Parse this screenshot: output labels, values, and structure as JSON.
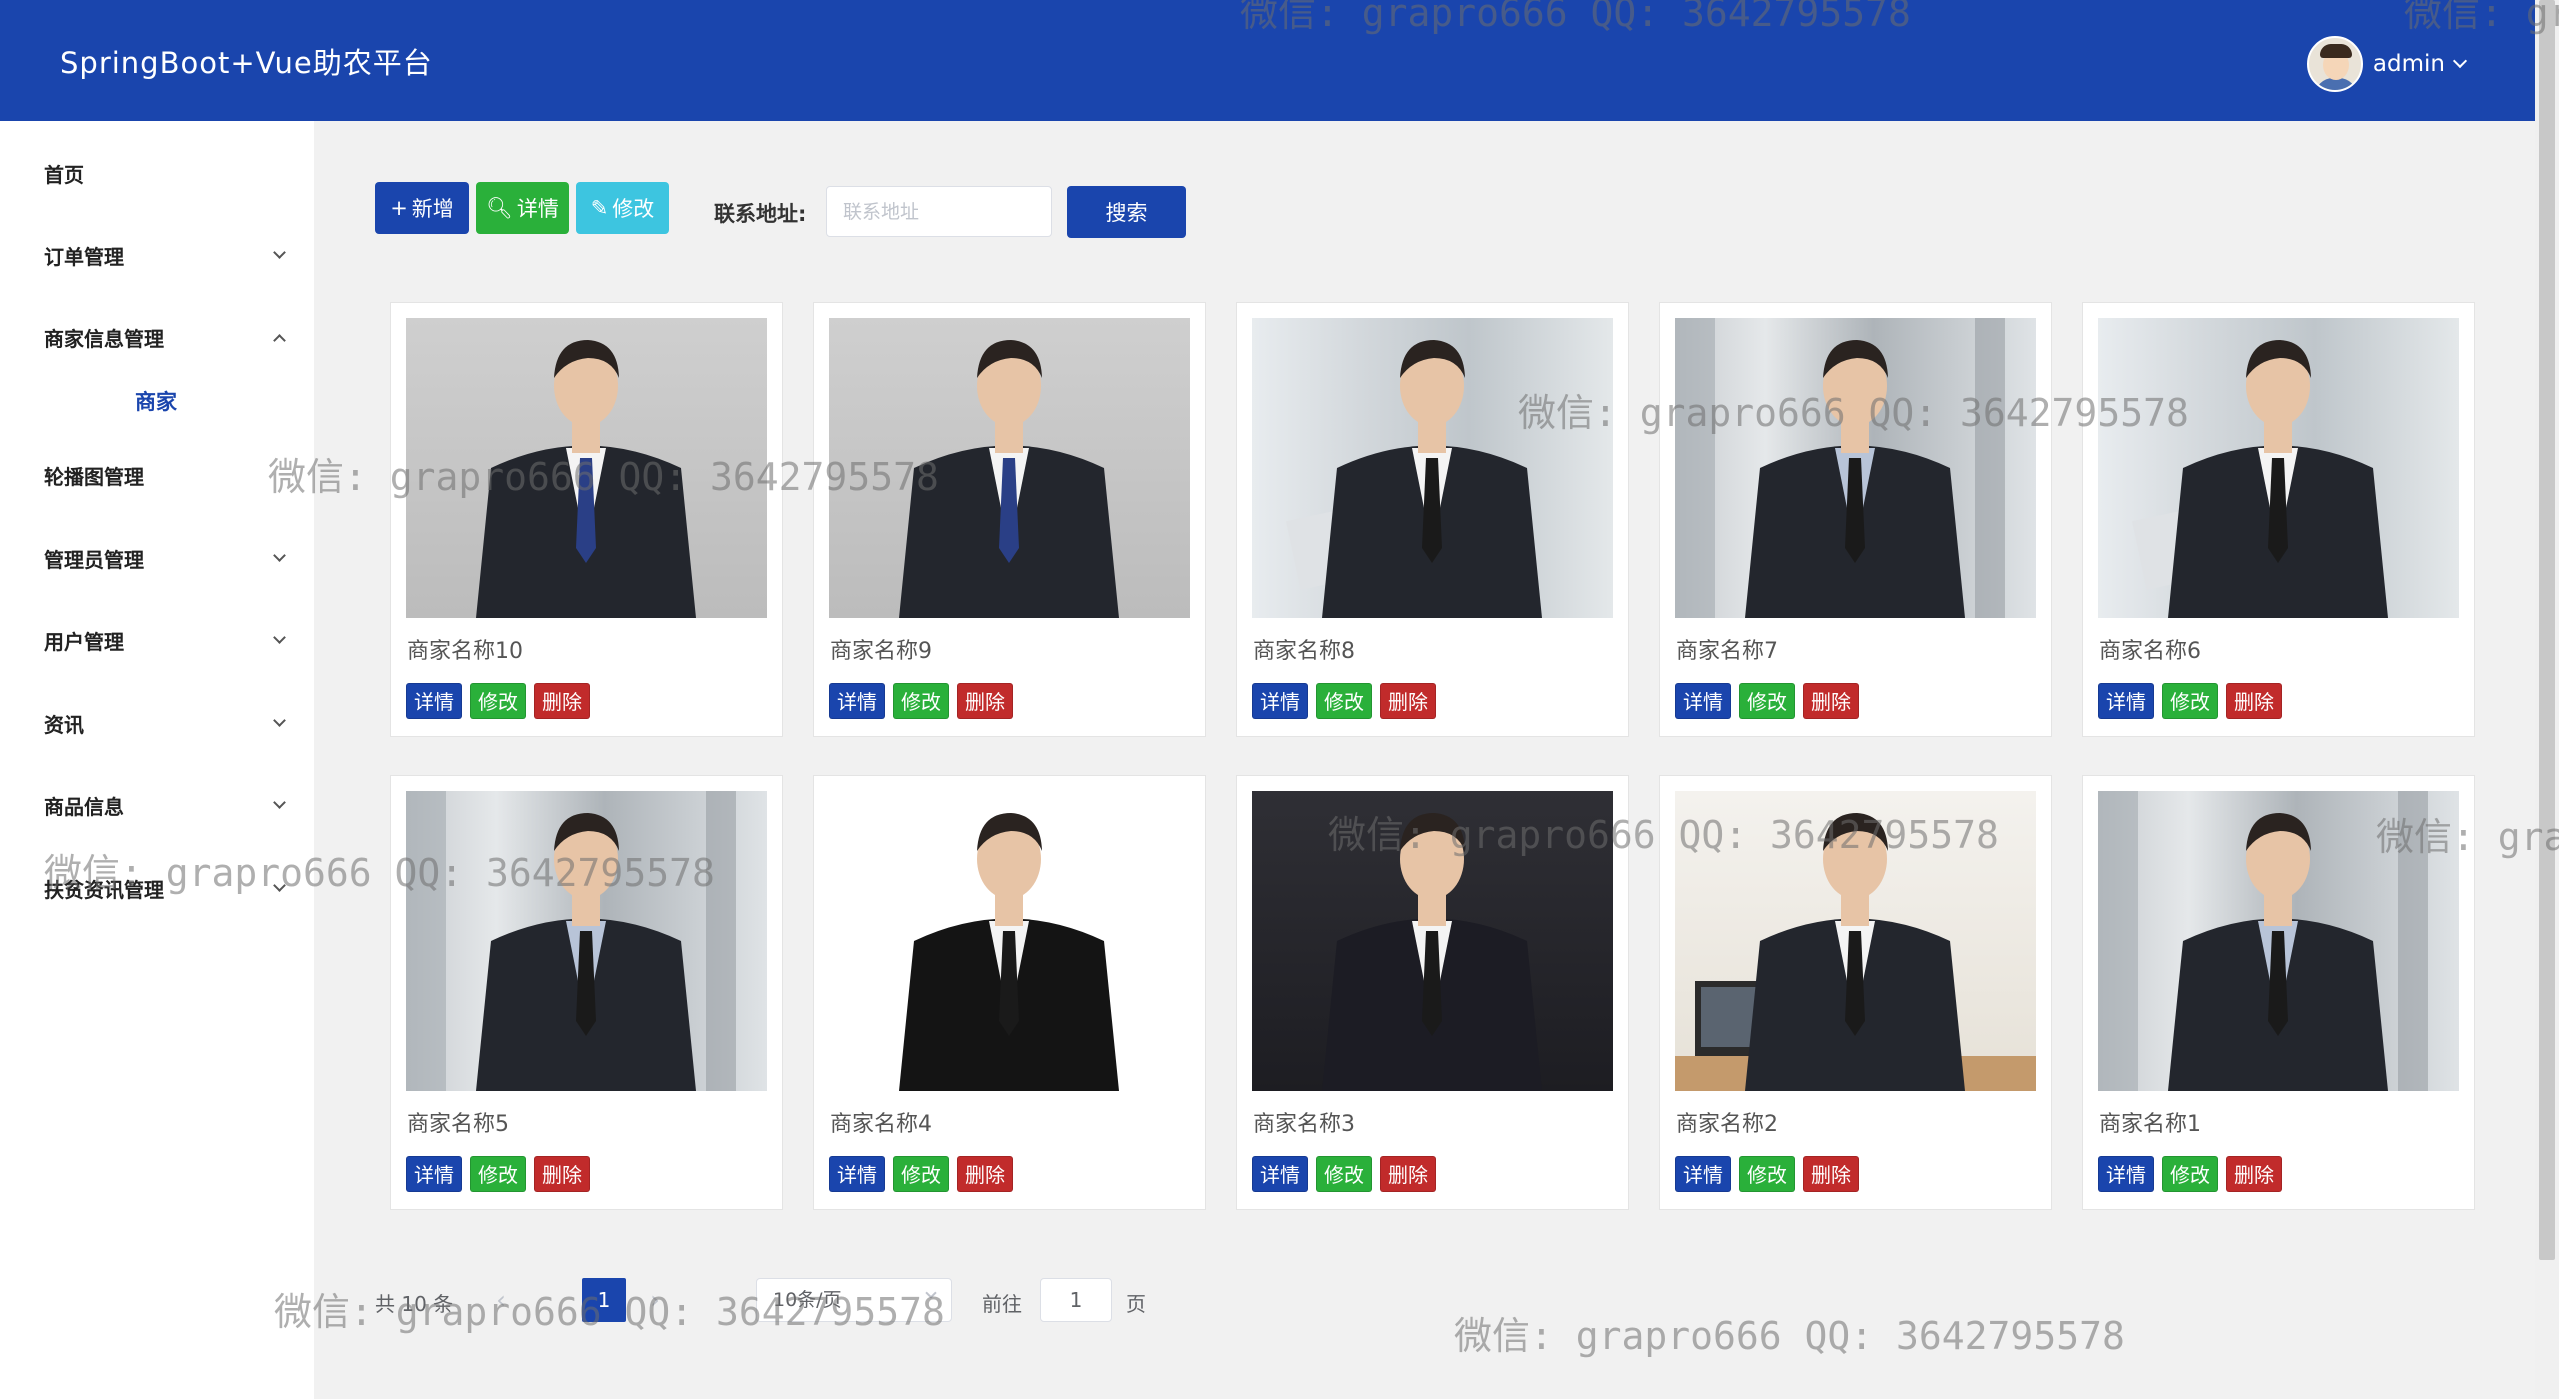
{
  "header": {
    "title": "SpringBoot+Vue助农平台",
    "username": "admin",
    "color": "#1a45ad"
  },
  "sidebar": {
    "items": [
      {
        "label": "首页"
      },
      {
        "label": "订单管理"
      },
      {
        "label": "商家信息管理",
        "expanded": true
      },
      {
        "label": "商家",
        "sub": true,
        "active": true
      },
      {
        "label": "轮播图管理"
      },
      {
        "label": "管理员管理"
      },
      {
        "label": "用户管理"
      },
      {
        "label": "资讯"
      },
      {
        "label": "商品信息"
      },
      {
        "label": "扶贫资讯管理"
      }
    ]
  },
  "toolbar": {
    "add_label": "新增",
    "detail_label": "详情",
    "edit_label": "修改",
    "address_label": "联系地址:",
    "address_placeholder": "联系地址",
    "address_value": "",
    "search_label": "搜索"
  },
  "cards": [
    {
      "name": "商家名称10",
      "photo": "man-suit-studio"
    },
    {
      "name": "商家名称9",
      "photo": "man-suit-studio"
    },
    {
      "name": "商家名称8",
      "photo": "man-laptop-office"
    },
    {
      "name": "商家名称7",
      "photo": "man-arms-crossed-station"
    },
    {
      "name": "商家名称6",
      "photo": "man-laptop-office"
    },
    {
      "name": "商家名称5",
      "photo": "man-arms-crossed-station"
    },
    {
      "name": "商家名称4",
      "photo": "man-black-suit"
    },
    {
      "name": "商家名称3",
      "photo": "woman-pinstripe-suit"
    },
    {
      "name": "商家名称2",
      "photo": "man-phone-desk"
    },
    {
      "name": "商家名称1",
      "photo": "man-arms-crossed-station"
    }
  ],
  "card_actions": {
    "detail": "详情",
    "edit": "修改",
    "delete": "删除"
  },
  "pagination": {
    "total_text": "共 10 条",
    "current_page": "1",
    "page_size": "10条/页",
    "goto_label": "前往",
    "goto_value": "1",
    "page_suffix": "页"
  },
  "watermark": {
    "text": "微信: grapro666 QQ: 3642795578",
    "short": "微信: gra"
  },
  "colors": {
    "primary": "#1a45ad",
    "success": "#2ab03a",
    "info": "#3dc5e0",
    "danger": "#c12b2b"
  }
}
